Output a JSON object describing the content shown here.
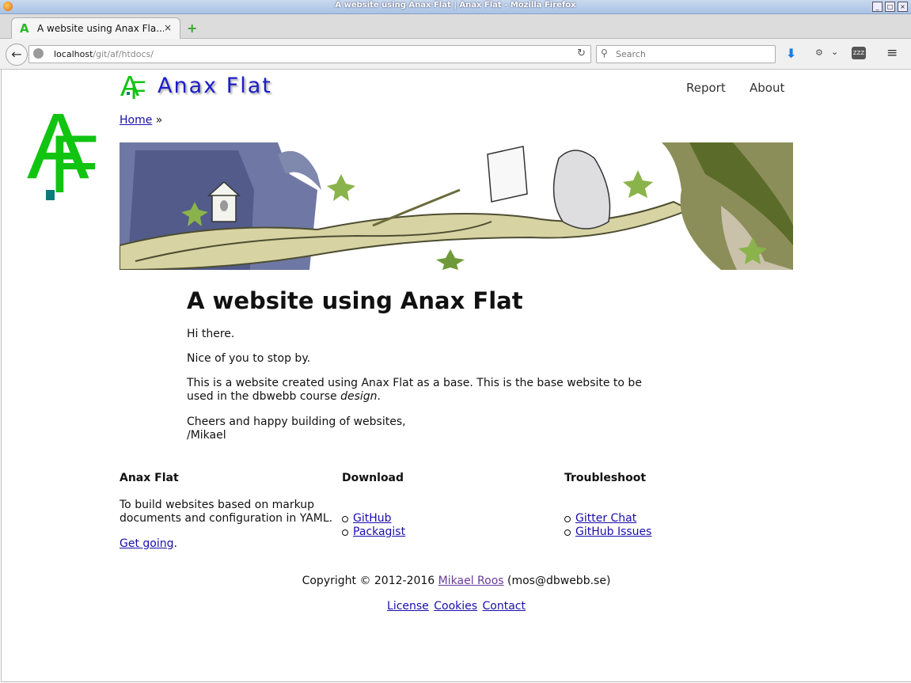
{
  "window": {
    "title": "A website using Anax Flat | Anax Flat - Mozilla Firefox",
    "controls": [
      "_",
      "□",
      "×"
    ]
  },
  "tab": {
    "title": "A website using Anax Fla...",
    "icon": "AF-favicon",
    "close": "×",
    "new_tab": "+"
  },
  "navbar": {
    "back": "←",
    "url_host": "localhost",
    "url_path": "/git/af/htdocs/",
    "reload": "↻",
    "search_placeholder": "Search",
    "search_icon": "🔍",
    "download_icon": "⬇",
    "ext_icon": "⚙",
    "ext_dropdown": "⌄",
    "zzz_label": "ZZZ",
    "menu_icon": "≡"
  },
  "site": {
    "logo_a": "A",
    "logo_f": "F",
    "title": "Anax Flat",
    "nav": [
      {
        "label": "Report"
      },
      {
        "label": "About"
      }
    ],
    "breadcrumb_home": "Home",
    "breadcrumb_sep": " »"
  },
  "content": {
    "heading": "A website using Anax Flat",
    "p1": "Hi there.",
    "p2": "Nice of you to stop by.",
    "p3_text": "This is a website created using Anax Flat as a base. This is the base website to be used in the dbwebb course ",
    "p3_em": "design",
    "p3_end": ".",
    "p4_line1": "Cheers and happy building of websites,",
    "p4_line2": "/Mikael"
  },
  "footer": {
    "col1": {
      "title": "Anax Flat",
      "text": "To build websites based on markup documents and configuration in YAML.",
      "link": "Get going",
      "after_link": "."
    },
    "col2": {
      "title": "Download",
      "links": [
        "GitHub",
        "Packagist"
      ]
    },
    "col3": {
      "title": "Troubleshoot",
      "links": [
        "Gitter Chat",
        "GitHub Issues"
      ]
    },
    "copyright_prefix": "Copyright © 2012-2016 ",
    "copyright_name": "Mikael Roos",
    "copyright_suffix": " (mos@dbwebb.se)",
    "links": [
      "License",
      "Cookies",
      "Contact"
    ]
  },
  "colors": {
    "logo_green": "#11c411",
    "logo_teal": "#0c7a7a",
    "title_blue": "#1c1cc8",
    "link_blue": "#1a0dab",
    "visited_purple": "#6a3a9a"
  }
}
